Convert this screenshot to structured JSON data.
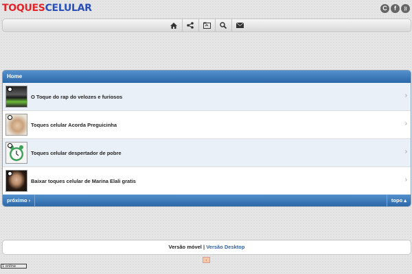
{
  "header": {
    "logo_part1": "TOQUES",
    "logo_part2": "CELULAR"
  },
  "social": [
    {
      "name": "orkut-icon",
      "glyph": "C"
    },
    {
      "name": "facebook-icon",
      "glyph": "f"
    },
    {
      "name": "rss-icon",
      "glyph": "))"
    }
  ],
  "toolbar": [
    "home-icon",
    "share-icon",
    "folder-icon",
    "search-icon",
    "mail-icon"
  ],
  "list": {
    "header": "Home",
    "items": [
      {
        "title": "O Toque do rap do velozes e furiosos"
      },
      {
        "title": "Toques celular Acorda Preguicinha"
      },
      {
        "title": "Toques celular despertador de pobre"
      },
      {
        "title": "Baixar toques celular de Marina Elali gratis"
      }
    ],
    "next_label": "próximo ›",
    "top_label": "topo ▴"
  },
  "version": {
    "mobile": "Versão móvel",
    "separator": "|",
    "desktop": "Versão Desktop"
  },
  "counter_label": "1 online"
}
